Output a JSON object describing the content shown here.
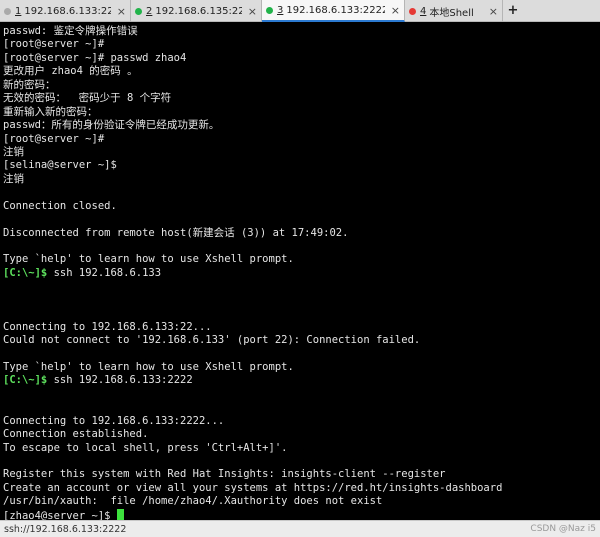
{
  "tabs": [
    {
      "num": "1",
      "title": "192.168.6.133:22",
      "dot_color": "#aaaaaa",
      "close": "×",
      "active": false
    },
    {
      "num": "2",
      "title": "192.168.6.135:22",
      "dot_color": "#21b34a",
      "close": "×",
      "active": false
    },
    {
      "num": "3",
      "title": "192.168.6.133:2222",
      "dot_color": "#21b34a",
      "close": "×",
      "active": true
    },
    {
      "num": "4",
      "title": "本地Shell",
      "dot_color": "#e53935",
      "close": "×",
      "active": false
    }
  ],
  "new_tab_label": "+",
  "terminal": {
    "lines": [
      "passwd: 鉴定令牌操作错误",
      "[root@server ~]#",
      "[root@server ~]# passwd zhao4",
      "更改用户 zhao4 的密码 。",
      "新的密码：",
      "无效的密码：  密码少于 8 个字符",
      "重新输入新的密码：",
      "passwd：所有的身份验证令牌已经成功更新。",
      "[root@server ~]#",
      "注销",
      "[selina@server ~]$",
      "注销",
      "",
      "Connection closed.",
      "",
      "Disconnected from remote host(新建会话 (3)) at 17:49:02.",
      "",
      "Type `help' to learn how to use Xshell prompt.",
      "",
      "",
      "",
      "",
      "Connecting to 192.168.6.133:22...",
      "Could not connect to '192.168.6.133' (port 22): Connection failed.",
      "",
      "Type `help' to learn how to use Xshell prompt.",
      "",
      "",
      "",
      "Connecting to 192.168.6.133:2222...",
      "Connection established.",
      "To escape to local shell, press 'Ctrl+Alt+]'.",
      "",
      "Register this system with Red Hat Insights: insights-client --register",
      "Create an account or view all your systems at https://red.ht/insights-dashboard",
      "/usr/bin/xauth:  file /home/zhao4/.Xauthority does not exist",
      ""
    ],
    "prompt_local_1": "[C:\\~]$",
    "cmd_local_1": " ssh 192.168.6.133",
    "prompt_local_2": "[C:\\~]$",
    "cmd_local_2": " ssh 192.168.6.133:2222",
    "final_prompt": "[zhao4@server ~]$ "
  },
  "status": {
    "left": "ssh://192.168.6.133:2222",
    "right": "CSDN @Naz i5"
  }
}
